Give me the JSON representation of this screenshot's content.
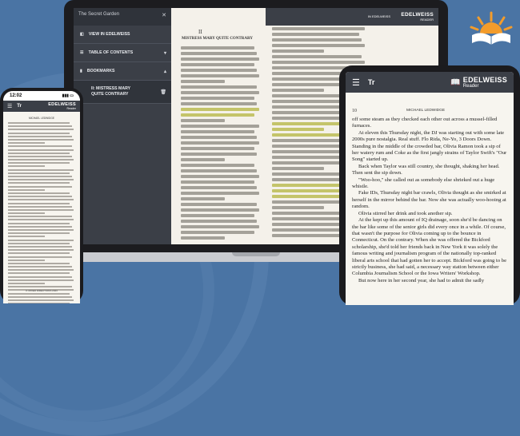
{
  "brand": {
    "logo_main": "EDELWEISS",
    "logo_sub": "Reader",
    "logo_sub_upper": "READER",
    "logo_corner": "IN EDELWEISS"
  },
  "laptop": {
    "panel": {
      "header": "The Secret Garden",
      "items": [
        {
          "label": "VIEW IN EDELWEISS"
        },
        {
          "label": "TABLE OF CONTENTS"
        },
        {
          "label": "BOOKMARKS"
        },
        {
          "label": "II: MISTRESS MARY QUITE CONTRARY"
        }
      ]
    },
    "page_number": "II",
    "chapter_title": "MISTRESS MARY QUITE CONTRARY"
  },
  "tablet": {
    "font_button": "Tr",
    "page_number": "10",
    "running_head": "MICHAEL LEDWIDGE",
    "paragraphs": [
      "off some steam as they checked each other out across a mussel-filled furnaces.",
      "At eleven this Thursday night, the DJ was starting out with some late 2000s pure nostalgia. Real stuff. Flo Rida, Ne-Yo, 3 Doors Down. Standing in the middle of the crowded bar, Olivia Ramon took a sip of her watery rum and Coke as the first jangly strains of Taylor Swift's \"Our Song\" started up.",
      "Back when Taylor was still country, she thought, shaking her head. Then sent the sip down.",
      "\"Woo-hoo,\" she called out as somebody else shrieked out a huge whistle.",
      "Fake IDs, Thursday night bar crawls, Olivia thought as she smirked at herself in the mirror behind the bar. Now she was actually woo-hooing at random.",
      "Olivia stirred her drink and took another sip.",
      "At the kept up this amount of IQ drainage, soon she'd be dancing on the bar like some of the senior girls did every once in a while. Of course, that wasn't the purpose for Olivia coming up to the bounce in Connecticut. On the contrary. When she was offered the Bickford scholarship, she'd told her friends back in New York it was solely the famous writing and journalism program of the nationally top-ranked liberal arts school that had gotten her to accept. Bickford was going to be strictly business, she had said, a necessary way station between either Columbia Journalism School or the Iowa Writers' Workshop.",
      "But now here in her second year, she had to admit the sadly"
    ]
  },
  "phone": {
    "time": "12:02",
    "font_button": "Tr",
    "running_head": "MICHAEL LEDWIDGE",
    "footer": "II: MIXED DIRECTIONS 2023"
  },
  "colors": {
    "background": "#4a74a4",
    "toolbar": "#3b3f47",
    "page": "#f4f1ea",
    "highlight": "#c4c46a",
    "sun_orange": "#f39c2b"
  }
}
